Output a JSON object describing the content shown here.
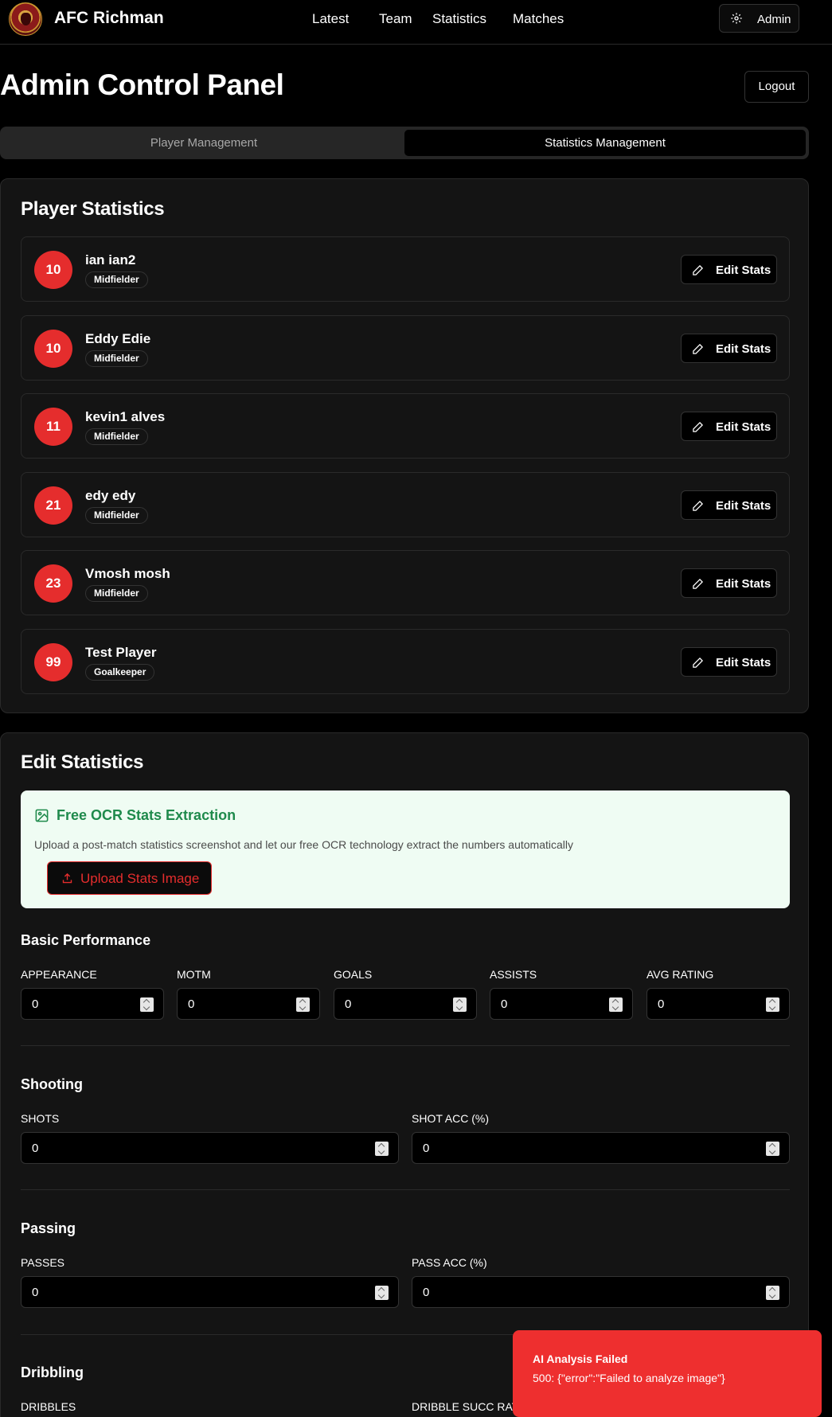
{
  "header": {
    "brand": "AFC Richman",
    "nav": [
      "Latest",
      "Team",
      "Statistics",
      "Matches"
    ],
    "admin_label": "Admin"
  },
  "page": {
    "title": "Admin Control Panel",
    "logout_label": "Logout"
  },
  "tabs": [
    {
      "label": "Player Management",
      "active": false
    },
    {
      "label": "Statistics Management",
      "active": true
    }
  ],
  "player_stats": {
    "title": "Player Statistics",
    "edit_label": "Edit Stats",
    "players": [
      {
        "number": "10",
        "name": "ian ian2",
        "position": "Midfielder"
      },
      {
        "number": "10",
        "name": "Eddy Edie",
        "position": "Midfielder"
      },
      {
        "number": "11",
        "name": "kevin1 alves",
        "position": "Midfielder"
      },
      {
        "number": "21",
        "name": "edy edy",
        "position": "Midfielder"
      },
      {
        "number": "23",
        "name": "Vmosh mosh",
        "position": "Midfielder"
      },
      {
        "number": "99",
        "name": "Test Player",
        "position": "Goalkeeper"
      }
    ]
  },
  "edit_stats": {
    "title": "Edit Statistics",
    "ocr": {
      "title": "Free OCR Stats Extraction",
      "description": "Upload a post-match statistics screenshot and let our free OCR technology extract the numbers automatically",
      "upload_label": "Upload Stats Image"
    },
    "basic": {
      "heading": "Basic Performance",
      "fields": [
        {
          "label": "APPEARANCE",
          "value": "0"
        },
        {
          "label": "MOTM",
          "value": "0"
        },
        {
          "label": "GOALS",
          "value": "0"
        },
        {
          "label": "ASSISTS",
          "value": "0"
        },
        {
          "label": "AVG RATING",
          "value": "0"
        }
      ]
    },
    "shooting": {
      "heading": "Shooting",
      "fields": [
        {
          "label": "SHOTS",
          "value": "0"
        },
        {
          "label": "SHOT ACC (%)",
          "value": "0"
        }
      ]
    },
    "passing": {
      "heading": "Passing",
      "fields": [
        {
          "label": "PASSES",
          "value": "0"
        },
        {
          "label": "PASS ACC (%)",
          "value": "0"
        }
      ]
    },
    "dribbling": {
      "heading": "Dribbling",
      "fields": [
        {
          "label": "DRIBBLES"
        },
        {
          "label": "DRIBBLE SUCC RATE (%)"
        }
      ]
    }
  },
  "toast": {
    "title": "AI Analysis Failed",
    "message": "500: {\"error\":\"Failed to analyze image\"}"
  },
  "colors": {
    "accent_red": "#e52d2d",
    "ocr_green": "#1f8a4c",
    "ocr_bg": "#effcf3",
    "toast_red": "#ee2f2f"
  }
}
